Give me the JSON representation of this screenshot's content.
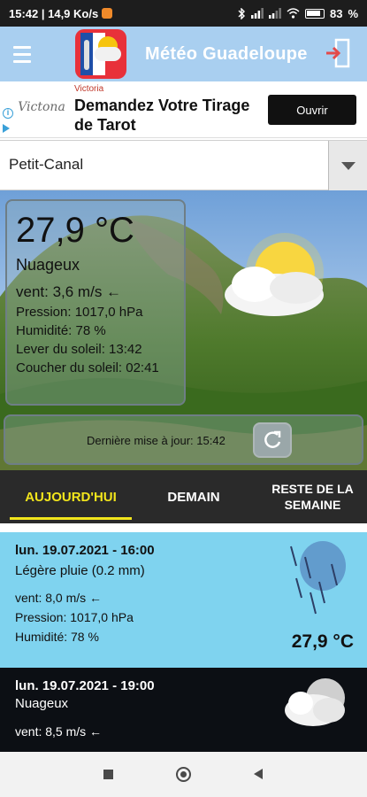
{
  "status_bar": {
    "time_speed": "15:42 | 14,9 Ko/s",
    "battery": "83"
  },
  "header": {
    "title": "Météo Guadeloupe",
    "menu_icon": "hamburger-icon",
    "logo_icon": "app-logo",
    "exit_icon": "exit-icon"
  },
  "ad": {
    "brand": "Victona",
    "sponsor": "Victoria",
    "headline": "Demandez Votre Tirage de Tarot",
    "cta": "Ouvrir"
  },
  "location": {
    "selected": "Petit-Canal"
  },
  "current": {
    "temperature": "27,9 °C",
    "condition": "Nuageux",
    "wind": "vent: 3,6 m/s ←",
    "pressure": "Pression: 1017,0 hPa",
    "humidity": "Humidité: 78 %",
    "sunrise": "Lever du soleil: 13:42",
    "sunset": "Coucher du soleil: 02:41",
    "last_update": "Dernière mise à jour: 15:42"
  },
  "tabs": [
    {
      "label": "AUJOURD'HUI"
    },
    {
      "label": "DEMAIN"
    },
    {
      "label": "RESTE DE LA SEMAINE"
    }
  ],
  "forecast": [
    {
      "datetime": "lun. 19.07.2021 - 16:00",
      "condition": "Légère pluie (0.2 mm)",
      "wind": "vent: 8,0 m/s ←",
      "pressure": "Pression: 1017,0 hPa",
      "humidity": "Humidité: 78 %",
      "temperature": "27,9 °C",
      "icon": "rain-icon"
    },
    {
      "datetime": "lun. 19.07.2021 - 19:00",
      "condition": "Nuageux",
      "wind": "vent: 8,5 m/s ←",
      "icon": "cloudy-night-icon"
    }
  ],
  "colors": {
    "header_bg": "#a9cff0",
    "tab_bar_bg": "#2a2a2a",
    "tab_active": "#f2e51c",
    "forecast_day_bg": "#7fd3ef",
    "forecast_night_bg": "#0c0f14"
  }
}
